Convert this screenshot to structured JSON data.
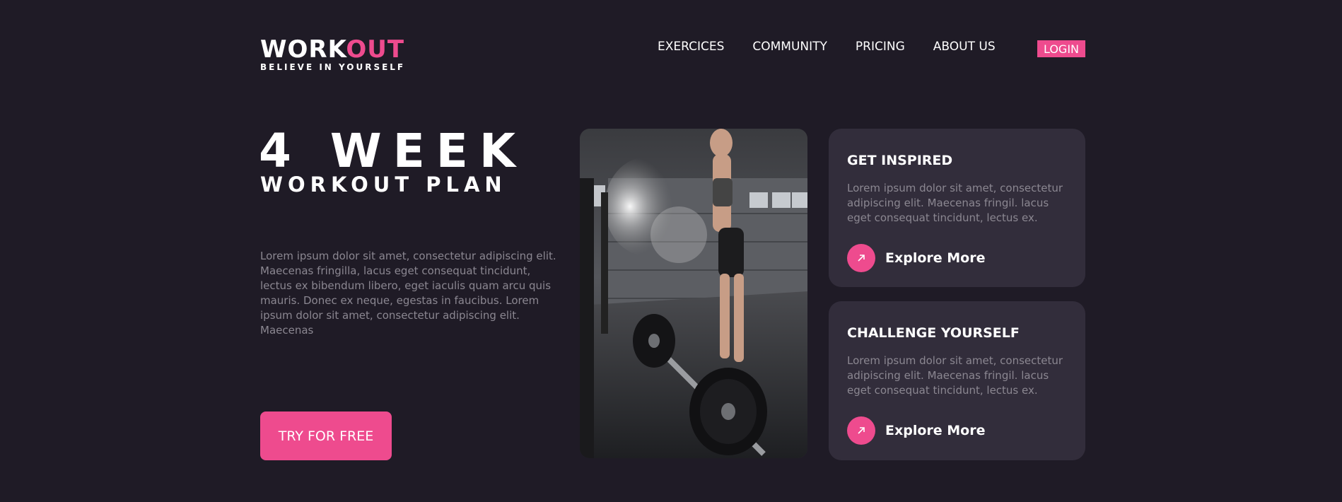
{
  "brand": {
    "word_white": "WORK",
    "word_pink": "OUT",
    "tagline": "BELIEVE IN YOURSELF"
  },
  "nav": {
    "items": [
      {
        "label": "EXERCICES"
      },
      {
        "label": "COMMUNITY"
      },
      {
        "label": "PRICING"
      },
      {
        "label": "ABOUT US"
      }
    ],
    "login_label": "LOGIN"
  },
  "hero": {
    "title_line1": "4 WEEK",
    "title_line2": "WORKOUT PLAN",
    "description": "Lorem ipsum dolor sit amet, consectetur adipiscing elit. Maecenas fringilla, lacus eget consequat tincidunt, lectus ex bibendum libero, eget iaculis quam arcu quis mauris. Donec ex neque, egestas in faucibus. Lorem ipsum dolor sit amet, consectetur adipiscing elit. Maecenas",
    "cta_label": "TRY FOR FREE"
  },
  "cards": [
    {
      "title": "GET INSPIRED",
      "text": "Lorem ipsum dolor sit amet, consectetur adipiscing elit. Maecenas fringil. lacus eget consequat tincidunt, lectus ex.",
      "link_label": "Explore More",
      "icon": "arrow-up-right-icon"
    },
    {
      "title": "CHALLENGE YOURSELF",
      "text": "Lorem ipsum dolor sit amet, consectetur adipiscing elit. Maecenas fringil. lacus eget consequat tincidunt, lectus ex.",
      "link_label": "Explore More",
      "icon": "arrow-up-right-icon"
    }
  ],
  "colors": {
    "background": "#1f1b26",
    "card": "#322d3b",
    "accent": "#ee4b8e",
    "muted_text": "#8b8791"
  }
}
